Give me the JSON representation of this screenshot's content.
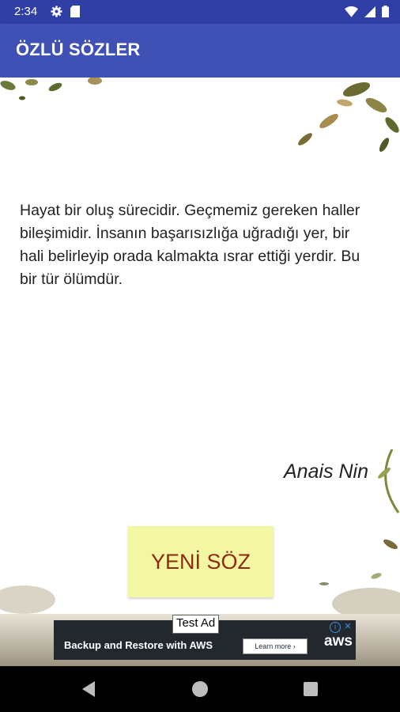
{
  "status_bar": {
    "time": "2:34"
  },
  "app_bar": {
    "title": "ÖZLÜ SÖZLER"
  },
  "quote": {
    "text": "Hayat bir oluş sürecidir. Geçmemiz gereken haller bileşimidir. İnsanın başarısızlığa uğradığı yer, bir hali belirleyip orada kalmakta ısrar ettiği yerdir. Bu bir tür ölümdür.",
    "author": "Anais Nin"
  },
  "new_quote_button": {
    "label": "YENİ SÖZ"
  },
  "ad": {
    "badge": "Test Ad",
    "headline": "Backup and Restore with AWS",
    "cta": "Learn more ›",
    "brand": "aws"
  },
  "colors": {
    "status_bar": "#2f3fa6",
    "app_bar": "#3f51b5",
    "button_bg": "#f3f7a3",
    "button_text": "#8e2a10"
  },
  "icons": {
    "status_left": [
      "settings-icon",
      "sd-card-icon"
    ],
    "status_right": [
      "wifi-icon",
      "signal-icon",
      "battery-icon"
    ],
    "nav": [
      "back-icon",
      "home-icon",
      "recents-icon"
    ]
  }
}
